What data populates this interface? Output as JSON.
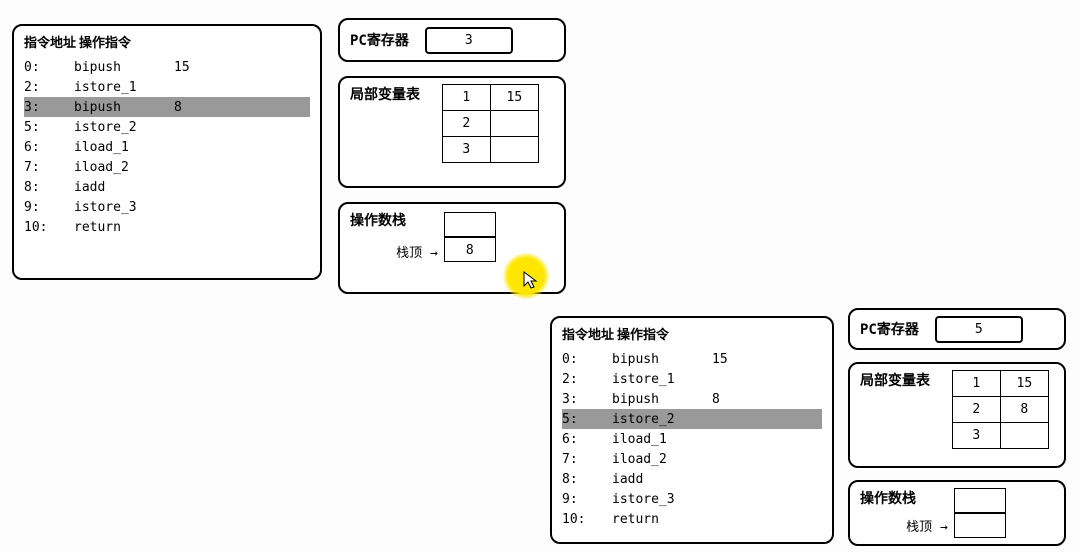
{
  "labels": {
    "instr_addr": "指令地址",
    "instr_op": "操作指令",
    "pc_register": "PC寄存器",
    "local_vars": "局部变量表",
    "operand_stack": "操作数栈",
    "stack_top": "栈顶"
  },
  "frame1": {
    "pc": "3",
    "instructions": [
      {
        "addr": "0:",
        "op": "bipush",
        "arg": "15",
        "hl": false
      },
      {
        "addr": "2:",
        "op": "istore_1",
        "arg": "",
        "hl": false
      },
      {
        "addr": "3:",
        "op": "bipush",
        "arg": "8",
        "hl": true
      },
      {
        "addr": "5:",
        "op": "istore_2",
        "arg": "",
        "hl": false
      },
      {
        "addr": "6:",
        "op": "iload_1",
        "arg": "",
        "hl": false
      },
      {
        "addr": "7:",
        "op": "iload_2",
        "arg": "",
        "hl": false
      },
      {
        "addr": "8:",
        "op": "iadd",
        "arg": "",
        "hl": false
      },
      {
        "addr": "9:",
        "op": "istore_3",
        "arg": "",
        "hl": false
      },
      {
        "addr": "10:",
        "op": "return",
        "arg": "",
        "hl": false
      }
    ],
    "local_vars": [
      {
        "idx": "1",
        "val": "15"
      },
      {
        "idx": "2",
        "val": ""
      },
      {
        "idx": "3",
        "val": ""
      }
    ],
    "stack": [
      "",
      "8"
    ]
  },
  "frame2": {
    "pc": "5",
    "instructions": [
      {
        "addr": "0:",
        "op": "bipush",
        "arg": "15",
        "hl": false
      },
      {
        "addr": "2:",
        "op": "istore_1",
        "arg": "",
        "hl": false
      },
      {
        "addr": "3:",
        "op": "bipush",
        "arg": "8",
        "hl": false
      },
      {
        "addr": "5:",
        "op": "istore_2",
        "arg": "",
        "hl": true
      },
      {
        "addr": "6:",
        "op": "iload_1",
        "arg": "",
        "hl": false
      },
      {
        "addr": "7:",
        "op": "iload_2",
        "arg": "",
        "hl": false
      },
      {
        "addr": "8:",
        "op": "iadd",
        "arg": "",
        "hl": false
      },
      {
        "addr": "9:",
        "op": "istore_3",
        "arg": "",
        "hl": false
      },
      {
        "addr": "10:",
        "op": "return",
        "arg": "",
        "hl": false
      }
    ],
    "local_vars": [
      {
        "idx": "1",
        "val": "15"
      },
      {
        "idx": "2",
        "val": "8"
      },
      {
        "idx": "3",
        "val": ""
      }
    ],
    "stack": [
      "",
      ""
    ]
  }
}
